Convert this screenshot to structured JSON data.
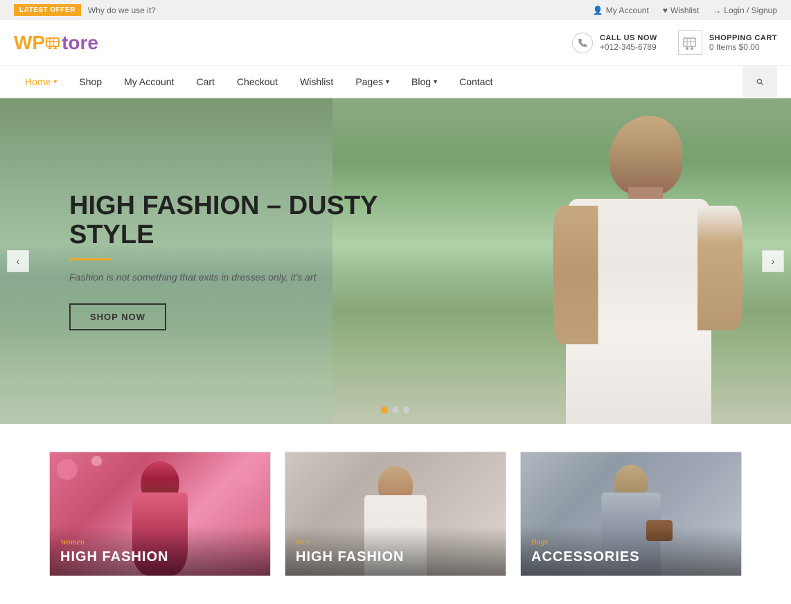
{
  "topbar": {
    "badge_label": "LATEST OFFER",
    "offer_text": "Why do we use it?",
    "my_account": "My Account",
    "wishlist": "Wishlist",
    "login": "Login / Signup"
  },
  "header": {
    "logo_wp": "WP",
    "logo_store": "store",
    "call_label": "CALL US NOW",
    "call_number": "+012-345-6789",
    "cart_label": "SHOPPING CART",
    "cart_items": "0 Items",
    "cart_total": "$0.00"
  },
  "navbar": {
    "items": [
      {
        "label": "Home",
        "has_arrow": true,
        "active": true
      },
      {
        "label": "Shop",
        "has_arrow": false,
        "active": false
      },
      {
        "label": "My Account",
        "has_arrow": false,
        "active": false
      },
      {
        "label": "Cart",
        "has_arrow": false,
        "active": false
      },
      {
        "label": "Checkout",
        "has_arrow": false,
        "active": false
      },
      {
        "label": "Wishlist",
        "has_arrow": false,
        "active": false
      },
      {
        "label": "Pages",
        "has_arrow": true,
        "active": false
      },
      {
        "label": "Blog",
        "has_arrow": true,
        "active": false
      },
      {
        "label": "Contact",
        "has_arrow": false,
        "active": false
      }
    ]
  },
  "hero": {
    "title": "HIGH FASHION – DUSTY STYLE",
    "subtitle": "Fashion is not something that exits in  dresses only, it's art",
    "btn_label": "SHOP NOW",
    "prev_icon": "‹",
    "next_icon": "›",
    "dots": [
      {
        "active": true
      },
      {
        "active": false
      },
      {
        "active": false
      }
    ]
  },
  "categories": [
    {
      "id": "women",
      "subtitle": "Women",
      "title": "High Fashion"
    },
    {
      "id": "men",
      "subtitle": "Men",
      "title": "High Fashion"
    },
    {
      "id": "bags",
      "subtitle": "Bags",
      "title": "ACCESSORIES"
    }
  ]
}
